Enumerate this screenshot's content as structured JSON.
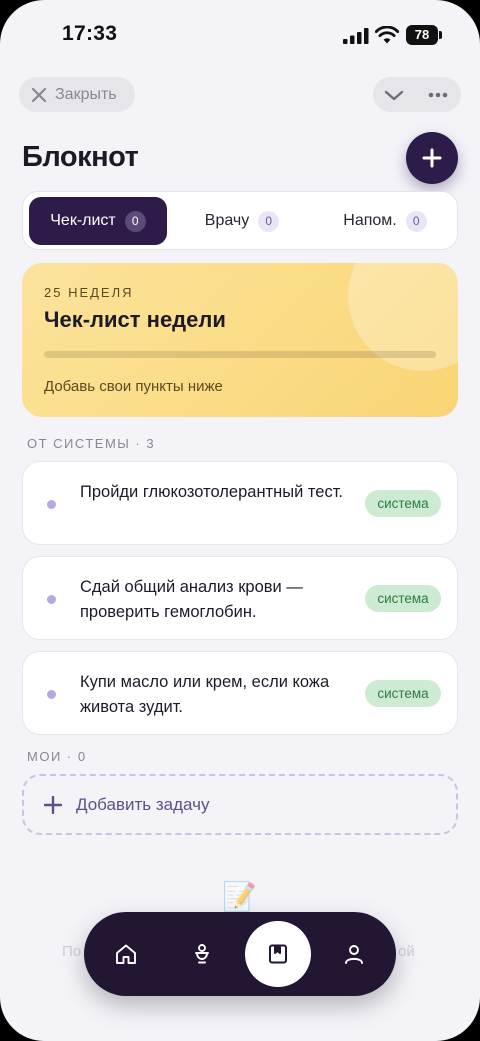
{
  "status_bar": {
    "time": "17:33",
    "battery": "78"
  },
  "top_bar": {
    "close_label": "Закрыть"
  },
  "header": {
    "title": "Блокнот"
  },
  "tabs": [
    {
      "label": "Чек-лист",
      "count": "0",
      "active": true
    },
    {
      "label": "Врачу",
      "count": "0",
      "active": false
    },
    {
      "label": "Напом.",
      "count": "0",
      "active": false
    }
  ],
  "week_card": {
    "overline": "25 НЕДЕЛЯ",
    "title": "Чек-лист недели",
    "progress": 0,
    "hint": "Добавь свои пункты ниже"
  },
  "system_section": {
    "label": "ОТ СИСТЕМЫ · 3"
  },
  "system_items": [
    {
      "text": "Пройди глюкозотолерантный тест.",
      "badge": "система"
    },
    {
      "text": "Сдай общий анализ крови — проверить гемоглобин.",
      "badge": "система"
    },
    {
      "text": "Купи масло или крем, если кожа живота зудит.",
      "badge": "система"
    }
  ],
  "mine_section": {
    "label": "МОИ · 0"
  },
  "add_task": {
    "label": "Добавить задачу"
  },
  "empty_state": {
    "emoji": "📝",
    "text_left": "По",
    "text_right": "ой"
  },
  "bottom_nav": {
    "items": [
      {
        "icon": "home-icon"
      },
      {
        "icon": "baby-icon"
      },
      {
        "icon": "notebook-icon",
        "active": true
      },
      {
        "icon": "profile-icon"
      }
    ]
  },
  "colors": {
    "accent": "#2d1c4a",
    "week_card": "#fbdc86",
    "badge_bg": "#cdebd3",
    "badge_text": "#2f7a45",
    "nav_bg": "#221632"
  }
}
